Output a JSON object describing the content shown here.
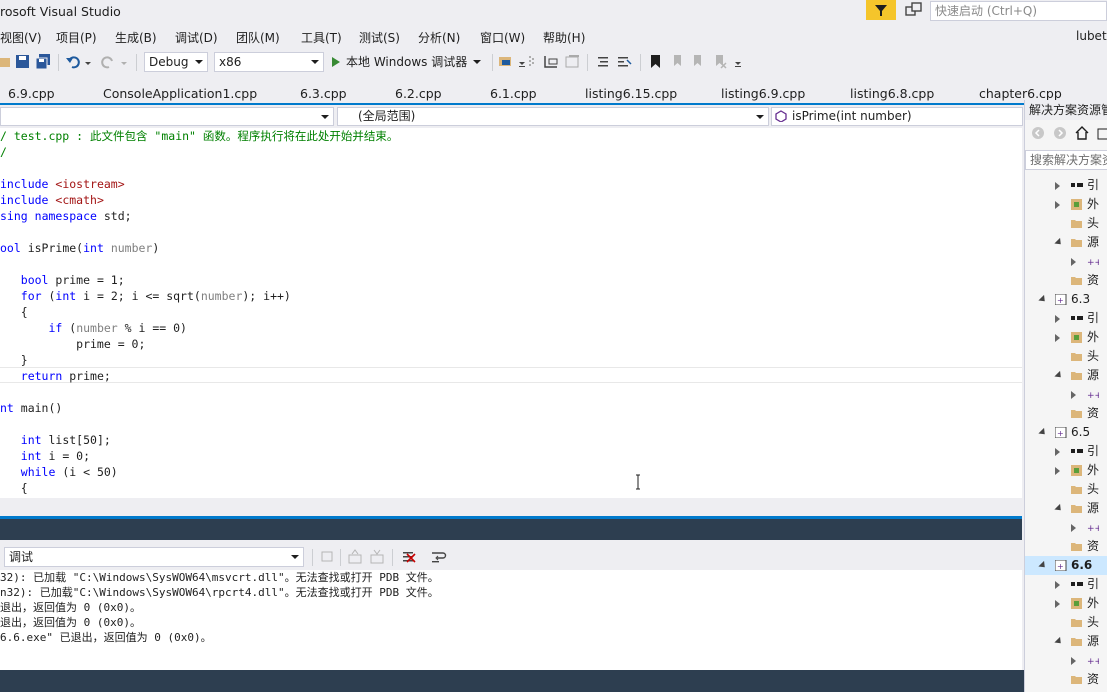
{
  "window": {
    "title": "rosoft Visual Studio",
    "quick_launch_placeholder": "快速启动 (Ctrl+Q)",
    "user": "lubet"
  },
  "menu": [
    "视图(V)",
    "项目(P)",
    "生成(B)",
    "调试(D)",
    "团队(M)",
    "工具(T)",
    "测试(S)",
    "分析(N)",
    "窗口(W)",
    "帮助(H)"
  ],
  "toolbar": {
    "config": "Debug",
    "platform": "x86",
    "run_label": "本地 Windows 调试器"
  },
  "tabs": [
    "6.9.cpp",
    "ConsoleApplication1.cpp",
    "6.3.cpp",
    "6.2.cpp",
    "6.1.cpp",
    "listing6.15.cpp",
    "listing6.9.cpp",
    "listing6.8.cpp",
    "chapter6.cpp"
  ],
  "nav": {
    "scope": "(全局范围)",
    "member": "isPrime(int number)"
  },
  "code": [
    "/ test.cpp : 此文件包含 \"main\" 函数。程序执行将在此处开始并结束。",
    "/",
    "",
    "include <iostream>",
    "include <cmath>",
    "sing namespace std;",
    "",
    "ool isPrime(int number)",
    "",
    "   bool prime = 1;",
    "   for (int i = 2; i <= sqrt(number); i++)",
    "   {",
    "       if (number % i == 0)",
    "           prime = 0;",
    "   }",
    "   return prime;",
    "",
    "nt main()",
    "",
    "   int list[50];",
    "   int i = 0;",
    "   while (i < 50)",
    "   {"
  ],
  "output": {
    "source": "调试",
    "lines": [
      "32): 已加载 \"C:\\Windows\\SysWOW64\\msvcrt.dll\"。无法查找或打开 PDB 文件。",
      "n32): 已加载\"C:\\Windows\\SysWOW64\\rpcrt4.dll\"。无法查找或打开 PDB 文件。",
      "退出，返回值为 0 (0x0)。",
      "退出，返回值为 0 (0x0)。",
      "6.6.exe\" 已退出，返回值为 0 (0x0)。"
    ]
  },
  "solution_explorer": {
    "title": "解决方案资源管",
    "search_placeholder": "搜索解决方案资",
    "rows": [
      {
        "text": "引",
        "kind": "ref",
        "indent": 1,
        "arrow": "right"
      },
      {
        "text": "外",
        "kind": "ext",
        "indent": 1,
        "arrow": "right"
      },
      {
        "text": "头",
        "kind": "folder",
        "indent": 1,
        "arrow": "none"
      },
      {
        "text": "源",
        "kind": "folder",
        "indent": 1,
        "arrow": "down"
      },
      {
        "text": "",
        "kind": "cpp",
        "indent": 2,
        "arrow": "right"
      },
      {
        "text": "资",
        "kind": "folder",
        "indent": 1,
        "arrow": "none"
      },
      {
        "text": "6.3",
        "kind": "project",
        "indent": 0,
        "arrow": "down"
      },
      {
        "text": "引",
        "kind": "ref",
        "indent": 1,
        "arrow": "right"
      },
      {
        "text": "外",
        "kind": "ext",
        "indent": 1,
        "arrow": "right"
      },
      {
        "text": "头",
        "kind": "folder",
        "indent": 1,
        "arrow": "none"
      },
      {
        "text": "源",
        "kind": "folder",
        "indent": 1,
        "arrow": "down"
      },
      {
        "text": "",
        "kind": "cpp",
        "indent": 2,
        "arrow": "right"
      },
      {
        "text": "资",
        "kind": "folder",
        "indent": 1,
        "arrow": "none"
      },
      {
        "text": "6.5",
        "kind": "project",
        "indent": 0,
        "arrow": "down"
      },
      {
        "text": "引",
        "kind": "ref",
        "indent": 1,
        "arrow": "right"
      },
      {
        "text": "外",
        "kind": "ext",
        "indent": 1,
        "arrow": "right"
      },
      {
        "text": "头",
        "kind": "folder",
        "indent": 1,
        "arrow": "none"
      },
      {
        "text": "源",
        "kind": "folder",
        "indent": 1,
        "arrow": "down"
      },
      {
        "text": "",
        "kind": "cpp",
        "indent": 2,
        "arrow": "right"
      },
      {
        "text": "资",
        "kind": "folder",
        "indent": 1,
        "arrow": "none"
      },
      {
        "text": "6.6",
        "kind": "project",
        "indent": 0,
        "arrow": "down",
        "selected": true
      },
      {
        "text": "引",
        "kind": "ref",
        "indent": 1,
        "arrow": "right"
      },
      {
        "text": "外",
        "kind": "ext",
        "indent": 1,
        "arrow": "right"
      },
      {
        "text": "头",
        "kind": "folder",
        "indent": 1,
        "arrow": "none"
      },
      {
        "text": "源",
        "kind": "folder",
        "indent": 1,
        "arrow": "down"
      },
      {
        "text": "",
        "kind": "cpp",
        "indent": 2,
        "arrow": "right"
      },
      {
        "text": "资",
        "kind": "folder",
        "indent": 1,
        "arrow": "none"
      }
    ]
  },
  "colors": {
    "accent": "#007acc",
    "keyword": "#0000ff",
    "comment": "#008000",
    "string": "#a31515",
    "param": "#808080",
    "status_bar": "#2d3e50",
    "notification": "#f5c52b"
  }
}
